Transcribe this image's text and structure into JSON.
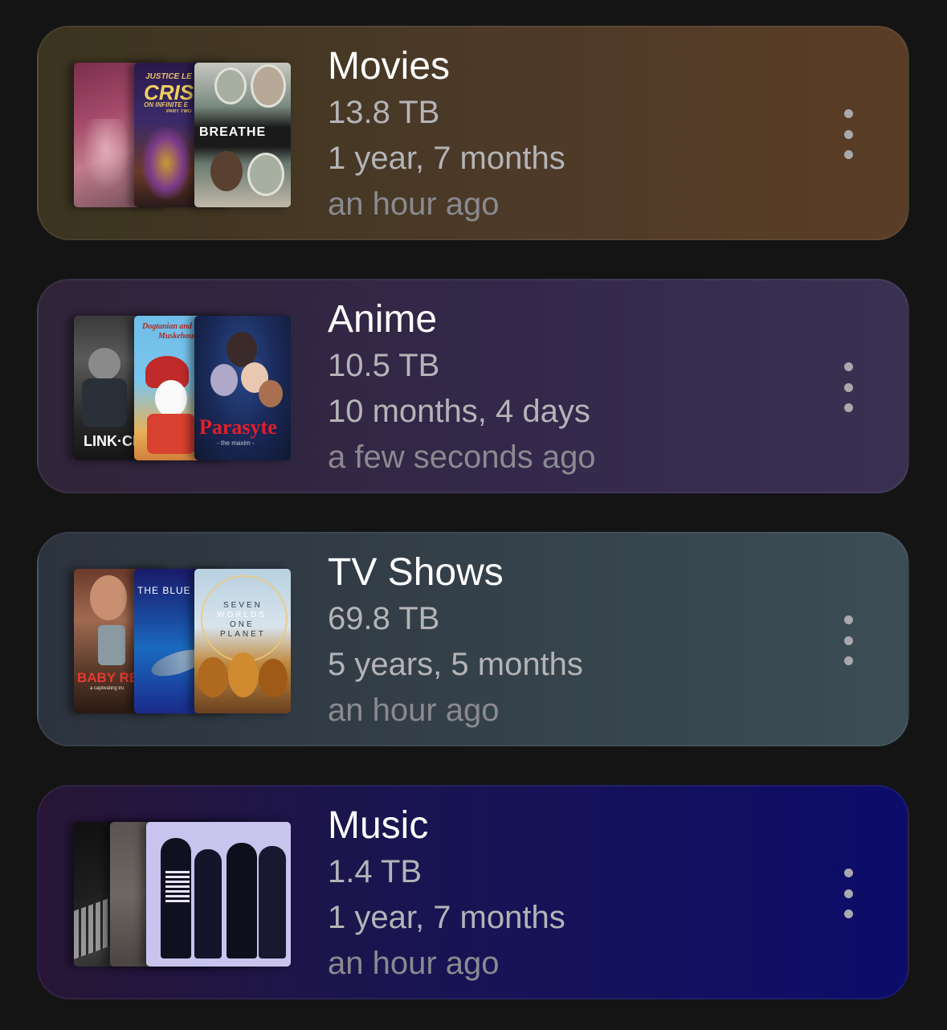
{
  "libraries": [
    {
      "title": "Movies",
      "size": "13.8 TB",
      "duration": "1 year, 7 months",
      "updated": "an hour ago",
      "posters": {
        "p2_lines": [
          "JUSTICE LE",
          "CRIS",
          "ON INFINITE E",
          "PART TWO"
        ],
        "p3_title": "BREATHE"
      }
    },
    {
      "title": "Anime",
      "size": "10.5 TB",
      "duration": "10 months, 4 days",
      "updated": "a few seconds ago",
      "posters": {
        "p1_title": "LINK·CL",
        "p2_lines": [
          "Dogtanian and t",
          "Muskehoun"
        ],
        "p3_title": "Parasyte",
        "p3_sub": "- the maxim -"
      }
    },
    {
      "title": "TV Shows",
      "size": "69.8 TB",
      "duration": "5 years, 5 months",
      "updated": "an hour ago",
      "posters": {
        "p1_title": "BABY REIN",
        "p1_sub": "a captivating tru",
        "p2_title": "THE BLUE P",
        "p3_lines": [
          "SEVEN",
          "WORLDS",
          "ONE",
          "PLANET"
        ]
      }
    },
    {
      "title": "Music",
      "size": "1.4 TB",
      "duration": "1 year, 7 months",
      "updated": "an hour ago"
    }
  ],
  "icons": {
    "menu": "more-vertical-icon"
  }
}
